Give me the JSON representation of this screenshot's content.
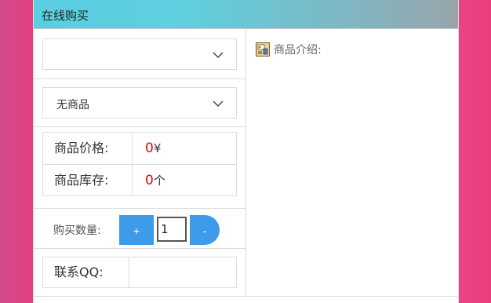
{
  "header": {
    "title": "在线购买"
  },
  "category_select": {
    "value": ""
  },
  "product_select": {
    "value": "无商品"
  },
  "price": {
    "label": "商品价格:",
    "value": "0",
    "unit": "¥"
  },
  "stock": {
    "label": "商品库存:",
    "value": "0",
    "unit": "个"
  },
  "quantity": {
    "label": "购买数量:",
    "plus_label": "+",
    "minus_label": "-",
    "value": "1"
  },
  "contact": {
    "label": "联系QQ:",
    "value": ""
  },
  "intro": {
    "label": "商品介绍:",
    "icon": "product-intro-icon"
  },
  "colors": {
    "accent": "#3d9be9",
    "value_red": "#e00000",
    "header_start": "#58cfe0",
    "header_end": "#9aa4aa"
  }
}
